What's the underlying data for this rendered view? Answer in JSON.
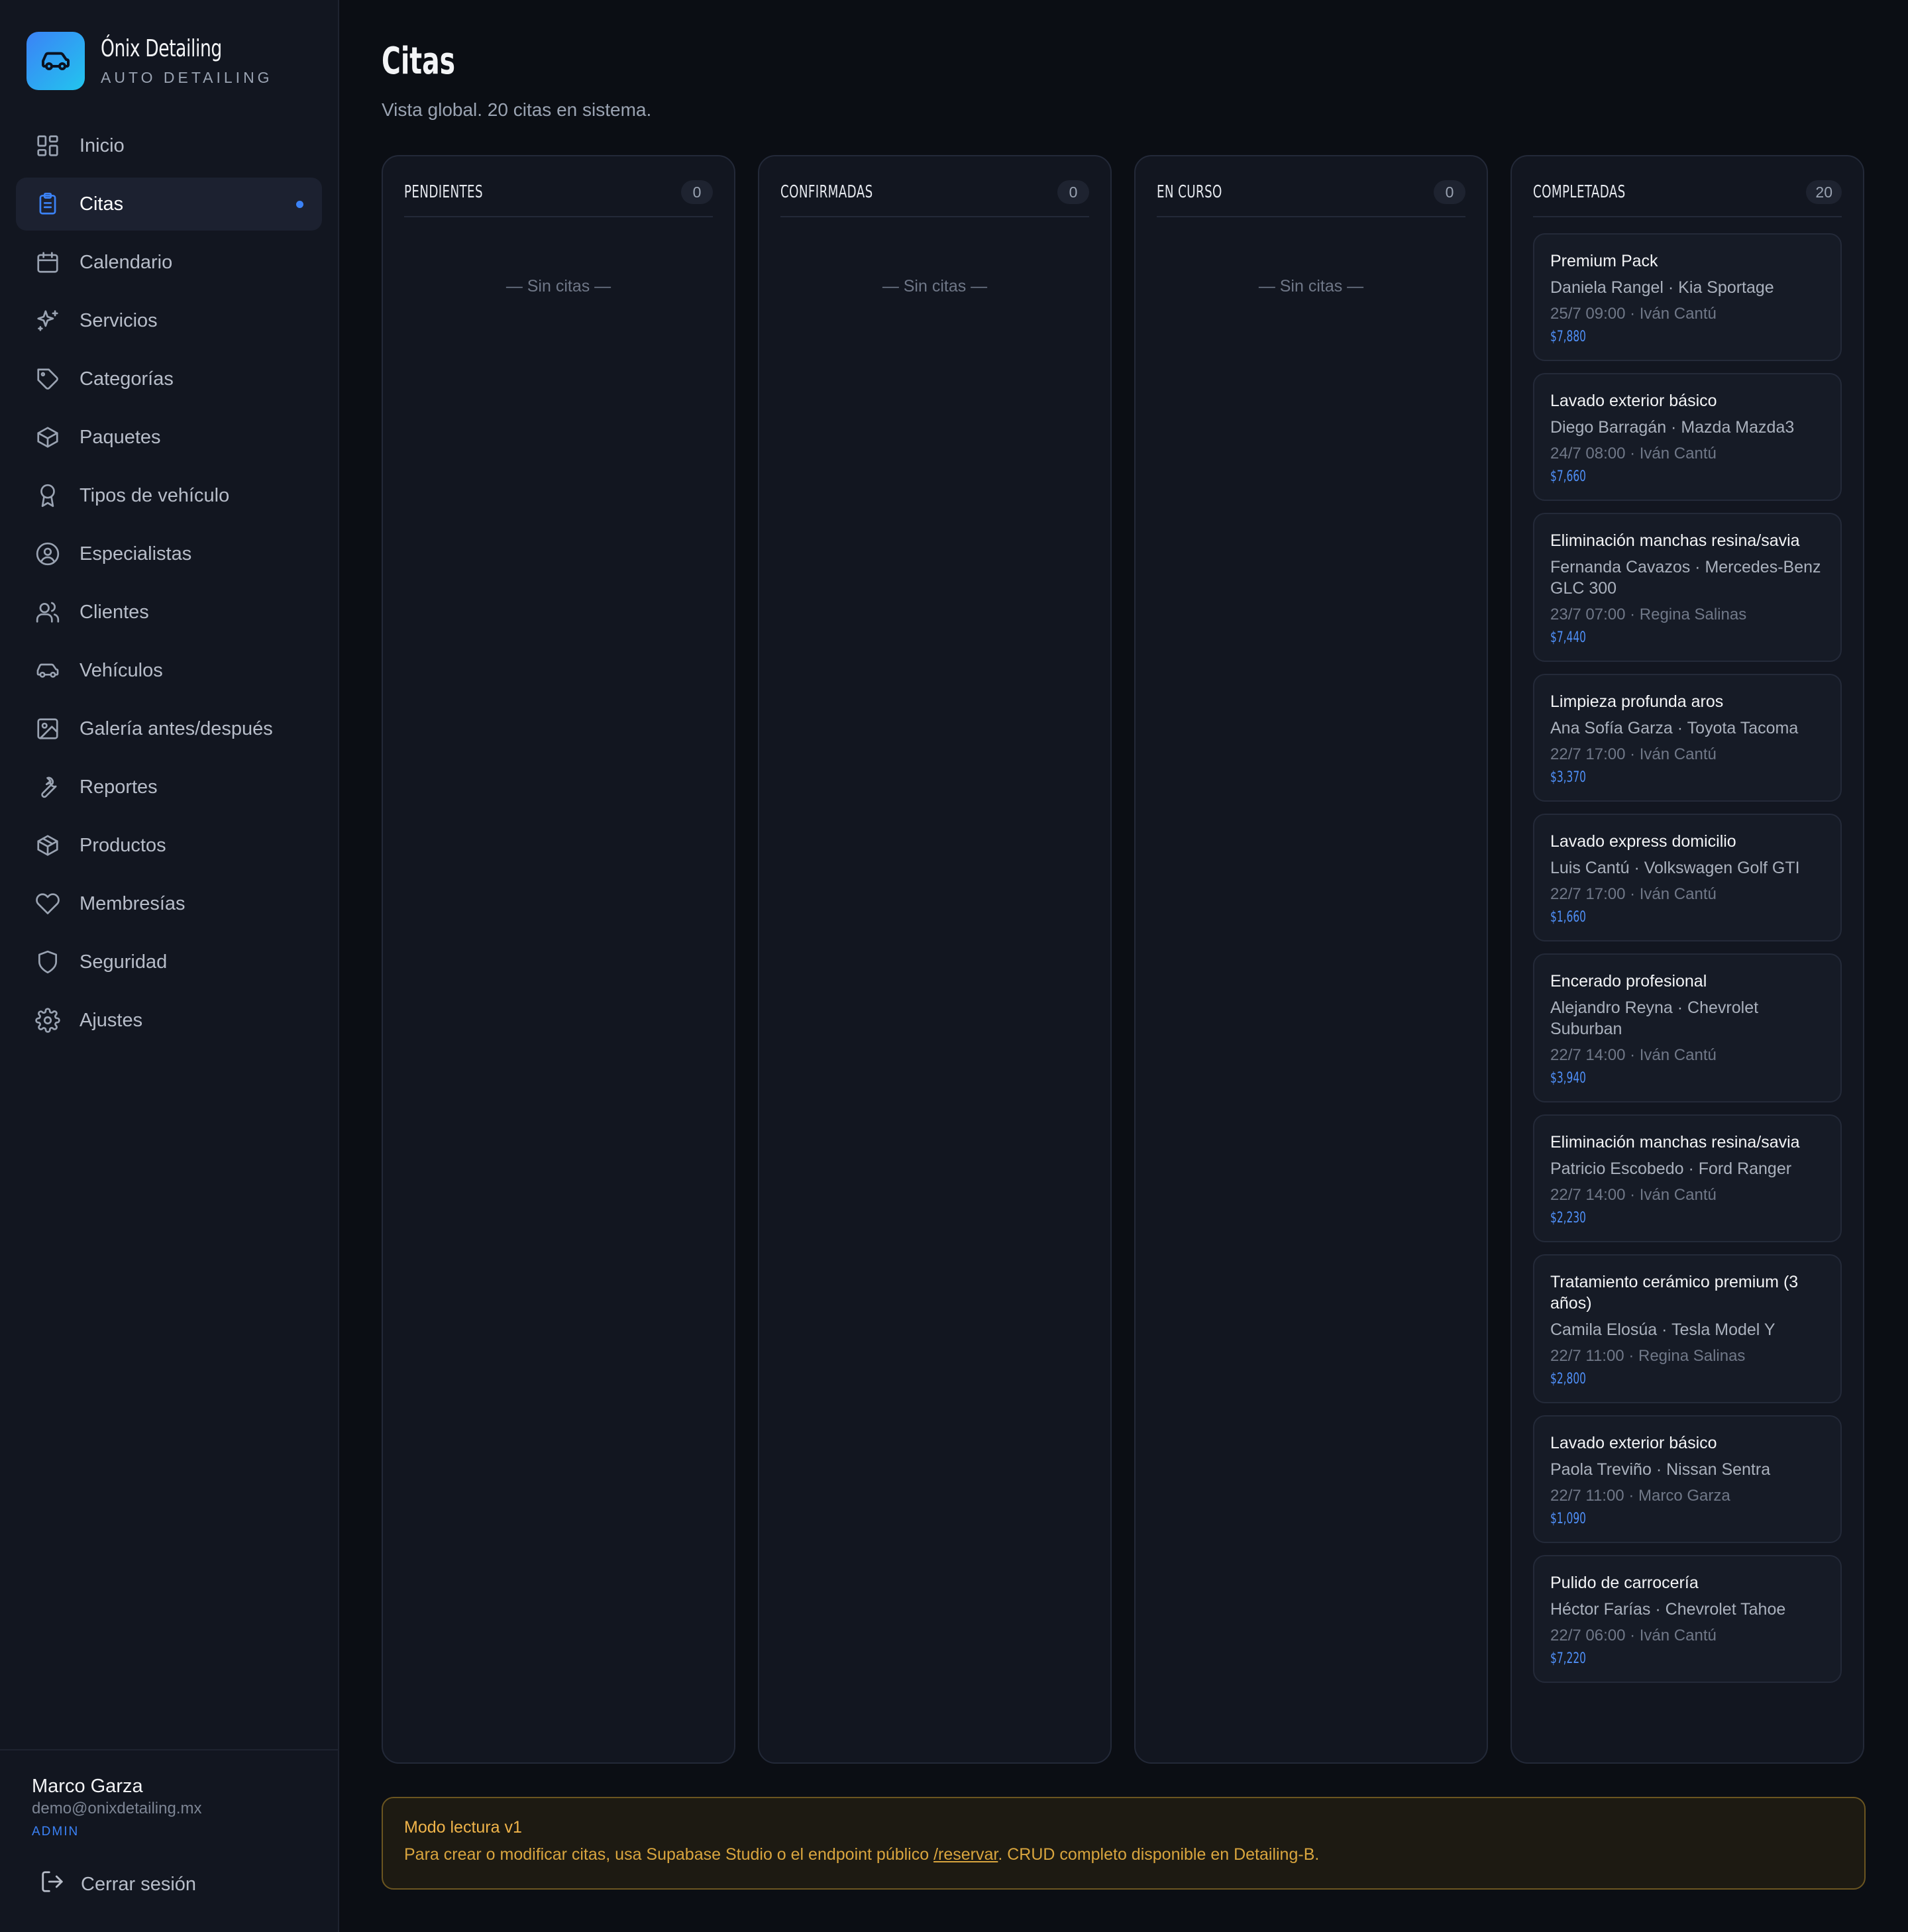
{
  "brand": {
    "name": "Ónix Detailing",
    "subtitle": "AUTO DETAILING",
    "logo_icon": "car-icon"
  },
  "nav": [
    {
      "label": "Inicio",
      "icon": "grid-icon",
      "active": false
    },
    {
      "label": "Citas",
      "icon": "clipboard-icon",
      "active": true
    },
    {
      "label": "Calendario",
      "icon": "calendar-icon",
      "active": false
    },
    {
      "label": "Servicios",
      "icon": "sparkles-icon",
      "active": false
    },
    {
      "label": "Categorías",
      "icon": "tag-icon",
      "active": false
    },
    {
      "label": "Paquetes",
      "icon": "package-icon",
      "active": false
    },
    {
      "label": "Tipos de vehículo",
      "icon": "award-icon",
      "active": false
    },
    {
      "label": "Especialistas",
      "icon": "user-circle-icon",
      "active": false
    },
    {
      "label": "Clientes",
      "icon": "users-icon",
      "active": false
    },
    {
      "label": "Vehículos",
      "icon": "car-icon",
      "active": false
    },
    {
      "label": "Galería antes/después",
      "icon": "image-icon",
      "active": false
    },
    {
      "label": "Reportes",
      "icon": "wrench-icon",
      "active": false
    },
    {
      "label": "Productos",
      "icon": "box-icon",
      "active": false
    },
    {
      "label": "Membresías",
      "icon": "heart-icon",
      "active": false
    },
    {
      "label": "Seguridad",
      "icon": "shield-icon",
      "active": false
    },
    {
      "label": "Ajustes",
      "icon": "gear-icon",
      "active": false
    }
  ],
  "user": {
    "name": "Marco Garza",
    "email": "demo@onixdetailing.mx",
    "role": "ADMIN",
    "logout_label": "Cerrar sesión"
  },
  "page": {
    "title": "Citas",
    "subtitle": "Vista global. 20 citas en sistema."
  },
  "columns": [
    {
      "title": "PENDIENTES",
      "count": "0",
      "empty_label": "— Sin citas —",
      "cards": []
    },
    {
      "title": "CONFIRMADAS",
      "count": "0",
      "empty_label": "— Sin citas —",
      "cards": []
    },
    {
      "title": "EN CURSO",
      "count": "0",
      "empty_label": "— Sin citas —",
      "cards": []
    },
    {
      "title": "COMPLETADAS",
      "count": "20",
      "empty_label": "",
      "cards": [
        {
          "service": "Premium Pack",
          "client": "Daniela Rangel · Kia Sportage",
          "meta": "25/7 09:00 · Iván Cantú",
          "price": "$7,880"
        },
        {
          "service": "Lavado exterior básico",
          "client": "Diego Barragán · Mazda Mazda3",
          "meta": "24/7 08:00 · Iván Cantú",
          "price": "$7,660"
        },
        {
          "service": "Eliminación manchas resina/savia",
          "client": "Fernanda Cavazos · Mercedes-Benz GLC 300",
          "meta": "23/7 07:00 · Regina Salinas",
          "price": "$7,440"
        },
        {
          "service": "Limpieza profunda aros",
          "client": "Ana Sofía Garza · Toyota Tacoma",
          "meta": "22/7 17:00 · Iván Cantú",
          "price": "$3,370"
        },
        {
          "service": "Lavado express domicilio",
          "client": "Luis Cantú · Volkswagen Golf GTI",
          "meta": "22/7 17:00 · Iván Cantú",
          "price": "$1,660"
        },
        {
          "service": "Encerado profesional",
          "client": "Alejandro Reyna · Chevrolet Suburban",
          "meta": "22/7 14:00 · Iván Cantú",
          "price": "$3,940"
        },
        {
          "service": "Eliminación manchas resina/savia",
          "client": "Patricio Escobedo · Ford Ranger",
          "meta": "22/7 14:00 · Iván Cantú",
          "price": "$2,230"
        },
        {
          "service": "Tratamiento cerámico premium (3 años)",
          "client": "Camila Elosúa · Tesla Model Y",
          "meta": "22/7 11:00 · Regina Salinas",
          "price": "$2,800"
        },
        {
          "service": "Lavado exterior básico",
          "client": "Paola Treviño · Nissan Sentra",
          "meta": "22/7 11:00 · Marco Garza",
          "price": "$1,090"
        },
        {
          "service": "Pulido de carrocería",
          "client": "Héctor Farías · Chevrolet Tahoe",
          "meta": "22/7 06:00 · Iván Cantú",
          "price": "$7,220"
        }
      ]
    }
  ],
  "notice": {
    "title": "Modo lectura v1",
    "text_before": "Para crear o modificar citas, usa Supabase Studio o el endpoint público ",
    "link": "/reservar",
    "text_after": ". CRUD completo disponible en Detailing-B."
  },
  "colors": {
    "accent": "#3b82f6",
    "background": "#0b0e14",
    "sidebar": "#121620",
    "notice": "#f0b44a"
  }
}
